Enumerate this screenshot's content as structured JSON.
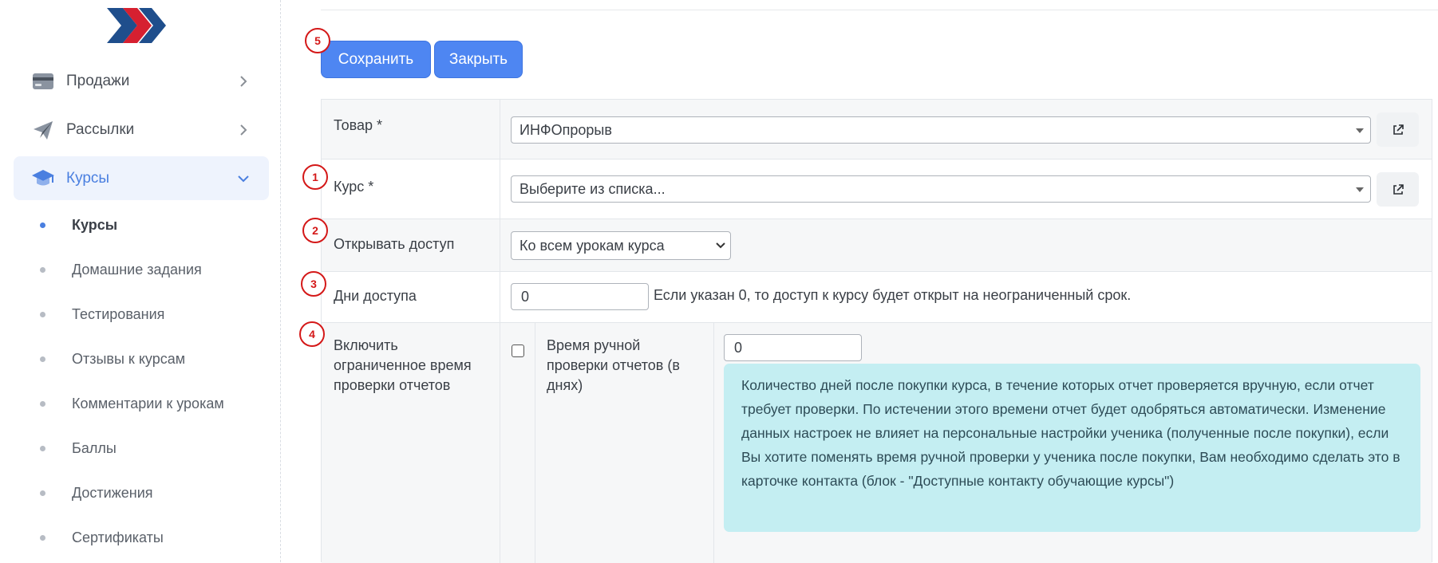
{
  "sidebar": {
    "items": [
      {
        "label": "Продажи",
        "icon": "credit-card-icon"
      },
      {
        "label": "Рассылки",
        "icon": "paper-plane-icon"
      },
      {
        "label": "Курсы",
        "icon": "graduation-cap-icon",
        "active": true
      }
    ],
    "sub_items": [
      {
        "label": "Курсы",
        "active": true
      },
      {
        "label": "Домашние задания"
      },
      {
        "label": "Тестирования"
      },
      {
        "label": "Отзывы к курсам"
      },
      {
        "label": "Комментарии к урокам"
      },
      {
        "label": "Баллы"
      },
      {
        "label": "Достижения"
      },
      {
        "label": "Сертификаты"
      }
    ]
  },
  "toolbar": {
    "save_label": "Сохранить",
    "close_label": "Закрыть"
  },
  "markers": [
    "1",
    "2",
    "3",
    "4",
    "5"
  ],
  "form": {
    "product": {
      "label": "Товар *",
      "value": "ИНФОпрорыв"
    },
    "course": {
      "label": "Курс *",
      "placeholder": "Выберите из списка..."
    },
    "access": {
      "label": "Открывать доступ",
      "value": "Ко всем урокам курса"
    },
    "days": {
      "label": "Дни доступа",
      "value": "0",
      "help": "Если указан 0, то доступ к курсу будет открыт на неограниченный срок."
    },
    "limited_check": {
      "label": "Включить ограниченное время проверки отчетов",
      "checked": false,
      "sub_label": "Время ручной проверки отчетов (в днях)",
      "value": "0",
      "info": "Количество дней после покупки курса, в течение которых отчет проверяется вручную, если отчет требует проверки. По истечении этого времени отчет будет одобряться автоматически. Изменение данных настроек не влияет на персональные настройки ученика (полученные после покупки), если Вы хотите поменять время ручной проверки у ученика после покупки, Вам необходимо сделать это в карточке контакта (блок - \"Доступные контакту обучающие курсы\")"
    }
  },
  "colors": {
    "primary": "#4e86f2",
    "active_bg": "#eef3fd",
    "active_text": "#4a7fe0",
    "info_bg": "#c4eef2",
    "marker": "#d41818"
  }
}
